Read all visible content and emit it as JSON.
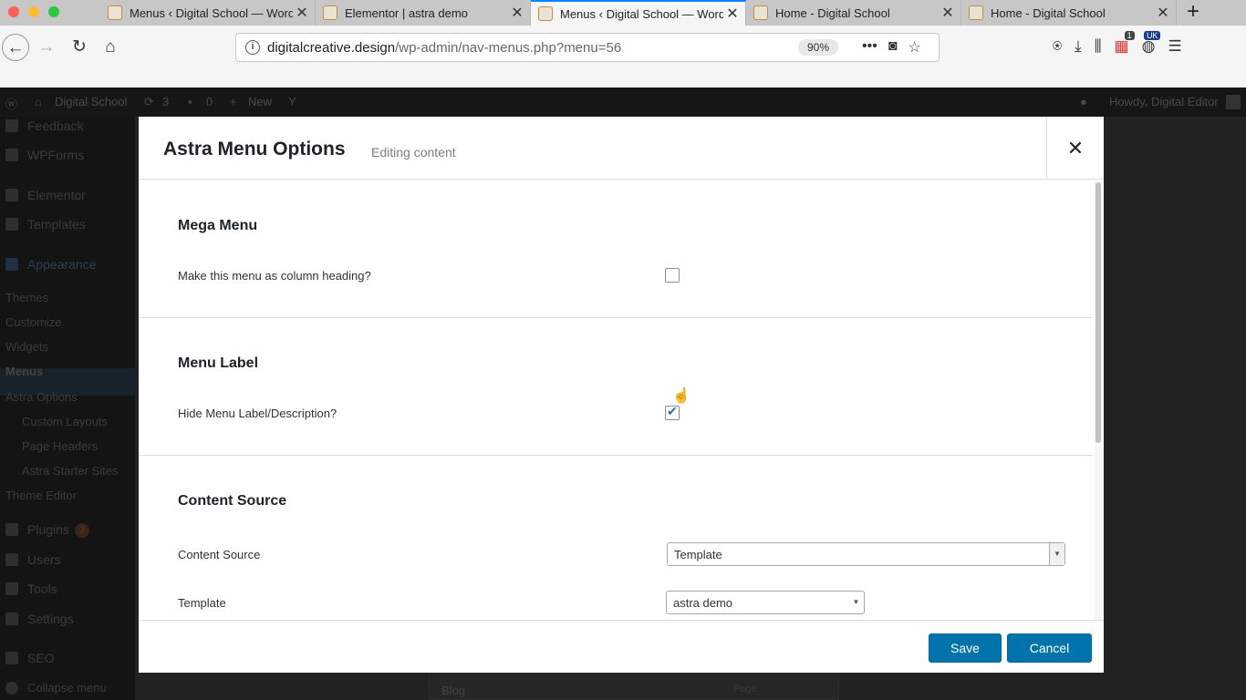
{
  "browser": {
    "tabs": [
      {
        "title": "Menus ‹ Digital School — Word",
        "active": false
      },
      {
        "title": "Elementor | astra demo",
        "active": false
      },
      {
        "title": "Menus ‹ Digital School — Word",
        "active": true
      },
      {
        "title": "Home - Digital School",
        "active": false
      },
      {
        "title": "Home - Digital School",
        "active": false
      }
    ],
    "close_glyph": "✕",
    "new_tab_glyph": "+",
    "url_domain": "digitalcreative.design",
    "url_path": "/wp-admin/nav-menus.php?menu=56",
    "zoom": "90%",
    "badge_count": "1",
    "badge_label": "UK"
  },
  "adminbar": {
    "site_name": "Digital School",
    "updates": "3",
    "comments": "0",
    "new_label": "New",
    "howdy": "Howdy, Digital Editor"
  },
  "sidebar": {
    "feedback": "Feedback",
    "wpforms": "WPForms",
    "elementor": "Elementor",
    "templates": "Templates",
    "appearance": "Appearance",
    "themes": "Themes",
    "customize": "Customize",
    "widgets": "Widgets",
    "menus": "Menus",
    "astra_options": "Astra Options",
    "custom_layouts": "Custom Layouts",
    "page_headers": "Page Headers",
    "astra_starter_sites": "Astra Starter Sites",
    "theme_editor": "Theme Editor",
    "plugins": "Plugins",
    "plugins_count": "3",
    "users": "Users",
    "tools": "Tools",
    "settings": "Settings",
    "seo": "SEO",
    "collapse": "Collapse menu"
  },
  "background": {
    "blog_label": "Blog",
    "page_label": "Page"
  },
  "modal": {
    "title": "Astra Menu Options",
    "subtitle": "Editing content",
    "close_glyph": "✕",
    "mega_menu": {
      "heading": "Mega Menu",
      "label": "Make this menu as column heading?",
      "checked": false
    },
    "menu_label": {
      "heading": "Menu Label",
      "label": "Hide Menu Label/Description?",
      "checked": true
    },
    "content_source": {
      "heading": "Content Source",
      "source_label": "Content Source",
      "source_value": "Template",
      "template_label": "Template",
      "template_value": "astra demo"
    },
    "save_label": "Save",
    "cancel_label": "Cancel"
  },
  "colors": {
    "primary": "#0073aa",
    "accent": "#2271b1",
    "firefox_blue": "#0a84ff"
  }
}
